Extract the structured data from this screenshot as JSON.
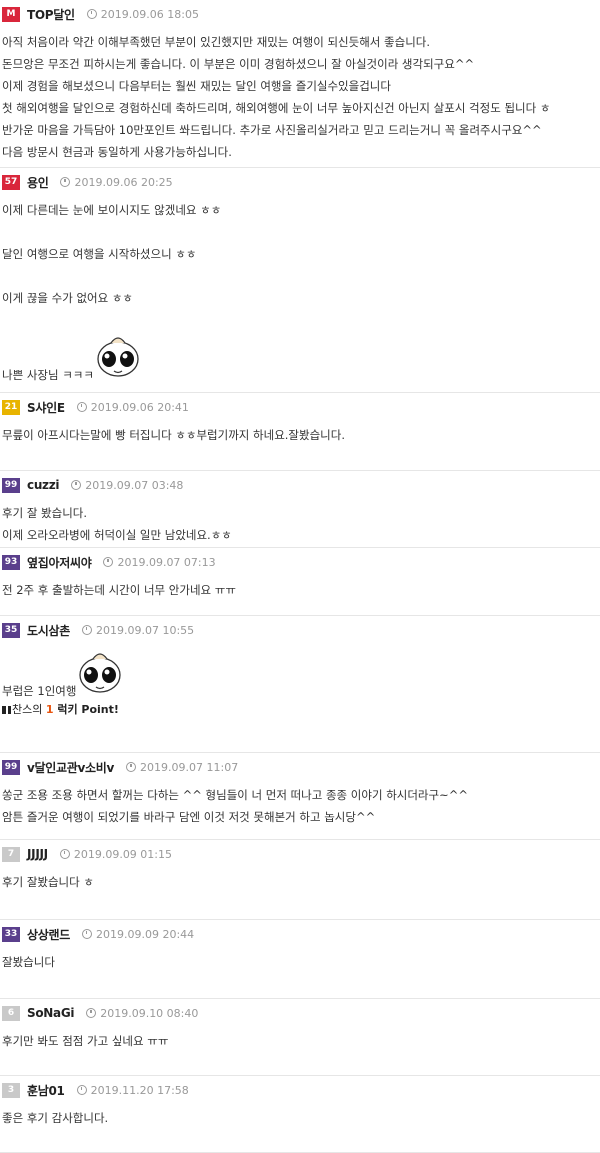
{
  "comments": [
    {
      "level": "M",
      "level_color": "#d9263b",
      "nick": "TOP달인",
      "date": "2019.09.06 18:05",
      "lines": [
        "아직 처음이라 약간 이해부족했던 부분이 있긴했지만 재밌는 여행이 되신듯해서 좋습니다.",
        "돈므앙은 무조건 피하시는게 좋습니다. 이 부분은 이미 경험하셨으니 잘 아실것이라 생각되구요^^",
        "이제 경험을 해보셨으니 다음부터는 훨씬 재밌는 달인 여행을 즐기실수있을겁니다",
        "첫 해외여행을 달인으로 경험하신데 축하드리며, 해외여행에 눈이 너무 높아지신건 아닌지 살포시 걱정도 됩니다 ㅎ",
        "반가운 마음을 가득담아 10만포인트 쏴드립니다. 추가로 사진올리실거라고 믿고 드리는거니 꼭 올려주시구요^^",
        "다음 방문시 현금과 동일하게 사용가능하십니다."
      ]
    },
    {
      "level": "57",
      "level_color": "#d9263b",
      "nick": "용인",
      "date": "2019.09.06 20:25",
      "lines": [
        "이제 다른데는 눈에 보이시지도 않겠네요 ㅎㅎ",
        "",
        "달인 여행으로 여행을 시작하셨으니 ㅎㅎ",
        "",
        "이게 끊을 수가 없어요 ㅎㅎ",
        "",
        "나쁜 사장님 ㅋㅋㅋ"
      ]
    },
    {
      "level": "21",
      "level_color": "#e8b400",
      "nick": "S샤인E",
      "date": "2019.09.06 20:41",
      "lines": [
        "무릎이 아프시다는말에 빵 터집니다 ㅎㅎ부럽기까지 하네요.잘봤습니다."
      ]
    },
    {
      "level": "99",
      "level_color": "#5a3f8c",
      "nick": "cuzzi",
      "date": "2019.09.07 03:48",
      "lines": [
        "후기 잘 봤습니다.",
        "이제 오라오라병에 허덕이실 일만 남았네요.ㅎㅎ"
      ]
    },
    {
      "level": "93",
      "level_color": "#5a3f8c",
      "nick": "옆집아저씨야",
      "date": "2019.09.07 07:13",
      "lines": [
        "전 2주 후 출발하는데 시간이 너무 안가네요 ㅠㅠ"
      ]
    },
    {
      "level": "35",
      "level_color": "#5a3f8c",
      "nick": "도시삼촌",
      "date": "2019.09.07 10:55",
      "lines": [
        "부럽은 1인여행"
      ],
      "bonus": {
        "prefix": "찬스의 ",
        "num": "1",
        "suffix": " 럭키 Point!"
      }
    },
    {
      "level": "99",
      "level_color": "#5a3f8c",
      "nick": "v달인교관v소비v",
      "date": "2019.09.07 11:07",
      "lines": [
        "쏭군 조용 조용 하면서 할꺼는 다하는 ^^ 형님들이 너 먼저 떠나고 종종 이야기 하시더라구~^^",
        "암튼 즐거운 여행이 되었기를 바라구 담엔 이것 저것 못해본거 하고 놉시당^^"
      ]
    },
    {
      "level": "7",
      "level_color": "#c9c9c9",
      "nick": "JJJJJ",
      "date": "2019.09.09 01:15",
      "lines": [
        "후기 잘봤습니다 ㅎ"
      ]
    },
    {
      "level": "33",
      "level_color": "#5a3f8c",
      "nick": "상상랜드",
      "date": "2019.09.09 20:44",
      "lines": [
        "잘봤습니다"
      ]
    },
    {
      "level": "6",
      "level_color": "#c9c9c9",
      "nick": "SoNaGi",
      "date": "2019.09.10 08:40",
      "lines": [
        "후기만 봐도 점점 가고 싶네요 ㅠㅠ"
      ]
    },
    {
      "level": "3",
      "level_color": "#c9c9c9",
      "nick": "훈남01",
      "date": "2019.11.20 17:58",
      "lines": [
        "좋은 후기 감사합니다."
      ]
    }
  ]
}
